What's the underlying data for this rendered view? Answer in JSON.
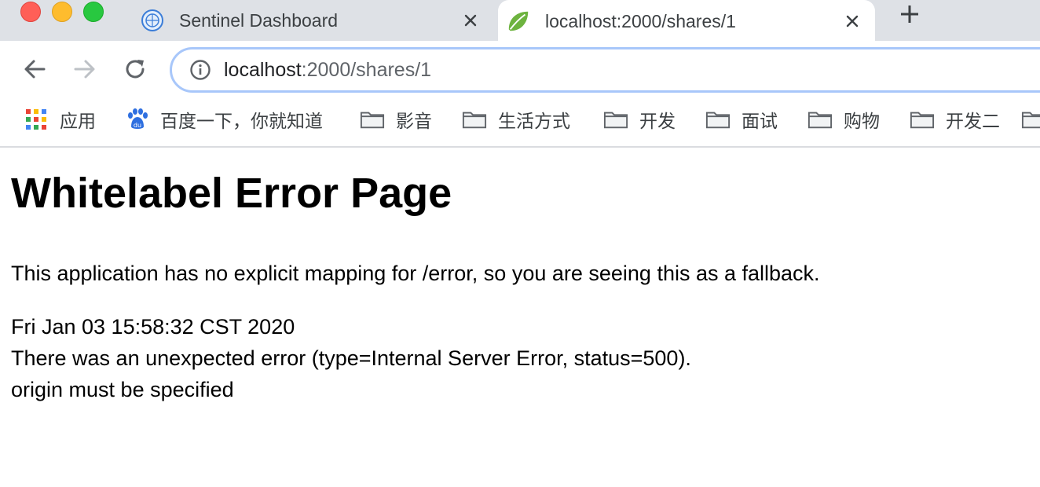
{
  "tabs": [
    {
      "title": "Sentinel Dashboard",
      "favicon": "sentinel-globe-icon",
      "active": false
    },
    {
      "title": "localhost:2000/shares/1",
      "favicon": "spring-leaf-icon",
      "active": true
    }
  ],
  "toolbar": {
    "url_host": "localhost",
    "url_rest": ":2000/shares/1"
  },
  "bookmarks": [
    {
      "label": "应用",
      "icon": "apps-grid-icon"
    },
    {
      "label": "百度一下，你就知道",
      "icon": "baidu-paw-icon"
    },
    {
      "label": "影音",
      "icon": "folder-icon"
    },
    {
      "label": "生活方式",
      "icon": "folder-icon"
    },
    {
      "label": "开发",
      "icon": "folder-icon"
    },
    {
      "label": "面试",
      "icon": "folder-icon"
    },
    {
      "label": "购物",
      "icon": "folder-icon"
    },
    {
      "label": "开发二",
      "icon": "folder-icon"
    }
  ],
  "page": {
    "title": "Whitelabel Error Page",
    "message": "This application has no explicit mapping for /error, so you are seeing this as a fallback.",
    "timestamp": "Fri Jan 03 15:58:32 CST 2020",
    "error_line": "There was an unexpected error (type=Internal Server Error, status=500).",
    "detail": "origin must be specified"
  },
  "colors": {
    "tabstrip_bg": "#dee1e6",
    "omnibox_focus": "#a8c7fa",
    "close_red": "#ff5f57",
    "minimize_yellow": "#febc2e",
    "zoom_green": "#28c840"
  }
}
